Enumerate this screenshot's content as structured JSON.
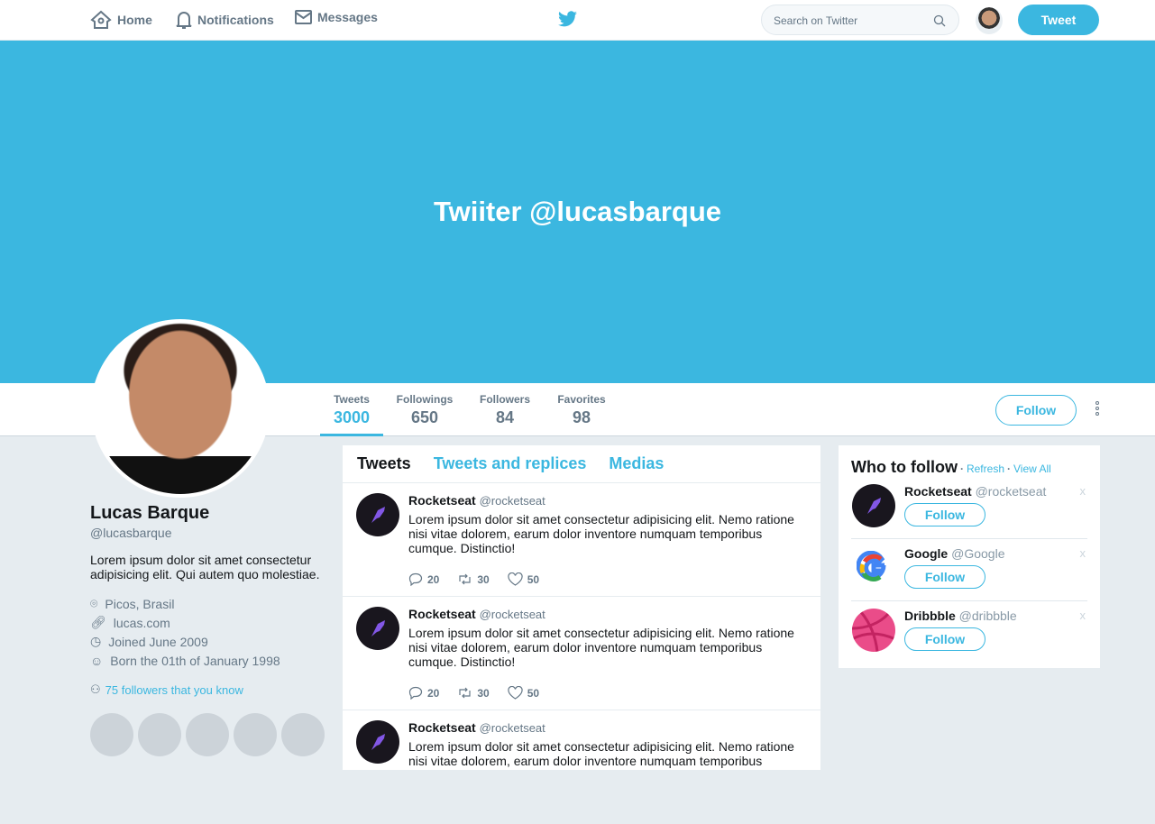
{
  "nav": {
    "home": "Home",
    "notifications": "Notifications",
    "messages": "Messages",
    "search_placeholder": "Search on Twitter",
    "tweet_button": "Tweet"
  },
  "banner": {
    "title": "Twiiter @lucasbarque"
  },
  "stats": [
    {
      "label": "Tweets",
      "value": "3000"
    },
    {
      "label": "Followings",
      "value": "650"
    },
    {
      "label": "Followers",
      "value": "84"
    },
    {
      "label": "Favorites",
      "value": "98"
    }
  ],
  "follow_button": "Follow",
  "profile": {
    "name": "Lucas Barque",
    "handle": "@lucasbarque",
    "bio": "Lorem ipsum dolor sit amet consectetur adipisicing elit. Qui autem quo molestiae.",
    "location": "Picos, Brasil",
    "website": "lucas.com",
    "joined": "Joined June 2009",
    "born": "Born the 01th of January 1998",
    "known_followers": "75 followers that you know"
  },
  "feed": {
    "tabs": [
      "Tweets",
      "Tweets and replices",
      "Medias"
    ],
    "tweets": [
      {
        "name": "Rocketseat",
        "handle": "@rocketseat",
        "text": "Lorem ipsum dolor sit amet consectetur adipisicing elit. Nemo ratione nisi vitae dolorem, earum dolor inventore numquam temporibus cumque. Distinctio!",
        "replies": "20",
        "retweets": "30",
        "likes": "50"
      },
      {
        "name": "Rocketseat",
        "handle": "@rocketseat",
        "text": "Lorem ipsum dolor sit amet consectetur adipisicing elit. Nemo ratione nisi vitae dolorem, earum dolor inventore numquam temporibus cumque. Distinctio!",
        "replies": "20",
        "retweets": "30",
        "likes": "50"
      },
      {
        "name": "Rocketseat",
        "handle": "@rocketseat",
        "text": "Lorem ipsum dolor sit amet consectetur adipisicing elit. Nemo ratione nisi vitae dolorem, earum dolor inventore numquam temporibus"
      }
    ]
  },
  "who_to_follow": {
    "title": "Who to follow",
    "refresh": "Refresh",
    "view_all": "View All",
    "sep": "·",
    "close": "x",
    "items": [
      {
        "name": "Rocketseat",
        "handle": "@rocketseat"
      },
      {
        "name": "Google",
        "handle": "@Google"
      },
      {
        "name": "Dribbble",
        "handle": "@dribbble"
      }
    ]
  },
  "colors": {
    "accent": "#3bb7e0",
    "background": "#e6ecf0"
  }
}
